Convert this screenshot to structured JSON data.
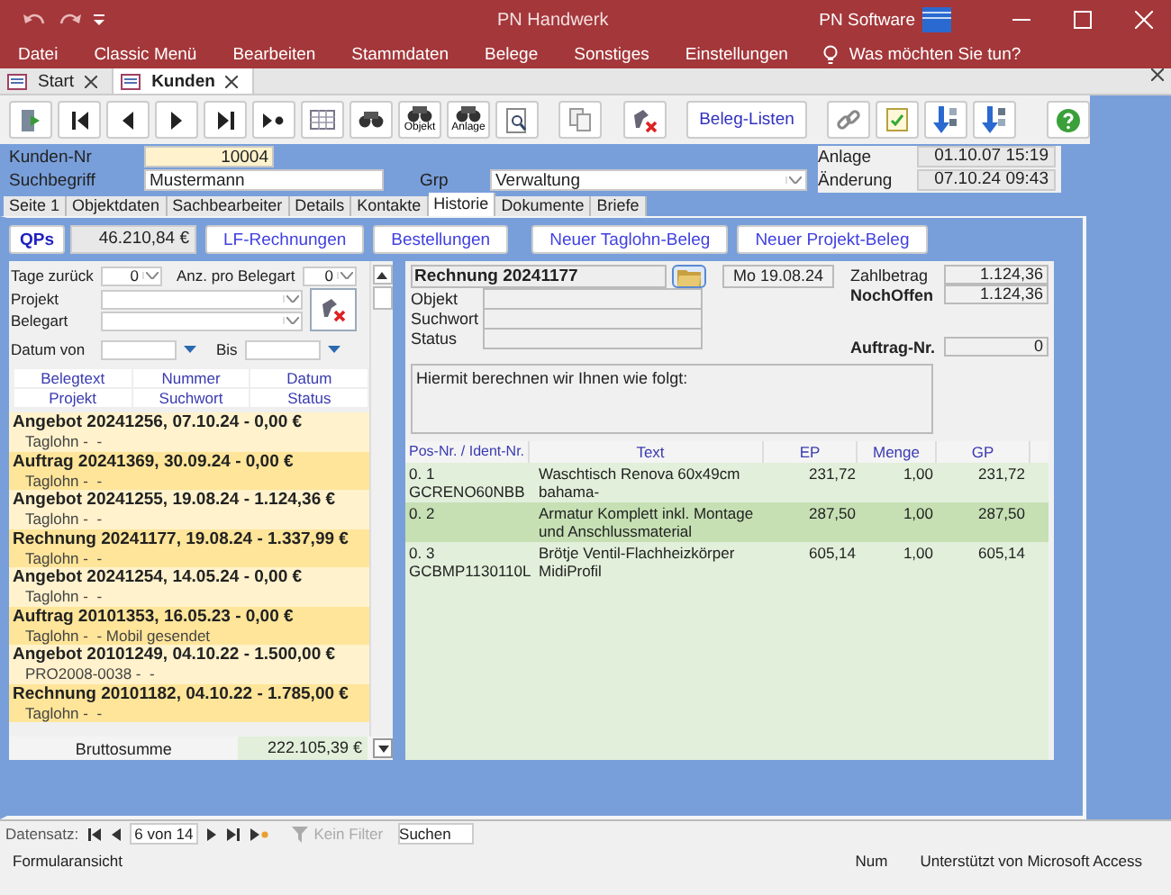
{
  "window": {
    "title": "PN Handwerk",
    "brand": "PN Software"
  },
  "menu": [
    "Datei",
    "Classic Menü",
    "Bearbeiten",
    "Stammdaten",
    "Belege",
    "Sonstiges",
    "Einstellungen"
  ],
  "tell_me": "Was möchten Sie tun?",
  "doc_tabs": [
    {
      "label": "Start",
      "selected": false
    },
    {
      "label": "Kunden",
      "selected": true
    }
  ],
  "toolbar_labels": [
    "Objekt",
    "Anlage",
    "Beleg-Listen"
  ],
  "header": {
    "kunden_nr": {
      "label": "Kunden-Nr",
      "value": "10004"
    },
    "suchbegriff": {
      "label": "Suchbegriff",
      "value": "Mustermann"
    },
    "grp": {
      "label": "Grp",
      "value": "Verwaltung"
    },
    "anlage": {
      "label": "Anlage",
      "value": "01.10.07 15:19"
    },
    "aenderung": {
      "label": "Änderung",
      "value": "07.10.24 09:43"
    }
  },
  "form_tabs": [
    {
      "label": "Seite 1",
      "selected": false
    },
    {
      "label": "Objektdaten",
      "selected": false
    },
    {
      "label": "Sachbearbeiter",
      "selected": false
    },
    {
      "label": "Details",
      "selected": false
    },
    {
      "label": "Kontakte",
      "selected": false
    },
    {
      "label": "Historie",
      "selected": true
    },
    {
      "label": "Dokumente",
      "selected": false
    },
    {
      "label": "Briefe",
      "selected": false
    }
  ],
  "actions": {
    "qps": "QPs",
    "total": "46.210,84 €",
    "buttons": [
      "LF-Rechnungen",
      "Bestellungen",
      "Neuer Taglohn-Beleg",
      "Neuer Projekt-Beleg"
    ]
  },
  "filters": {
    "tage_zurueck": {
      "label": "Tage zurück",
      "value": "0"
    },
    "anz": {
      "label": "Anz. pro Belegart",
      "value": "0"
    },
    "projekt": {
      "label": "Projekt"
    },
    "belegart": {
      "label": "Belegart"
    },
    "datum_von": {
      "label": "Datum von"
    },
    "bis": {
      "label": "Bis"
    }
  },
  "list_columns": [
    [
      "Belegtext",
      "Nummer",
      "Datum"
    ],
    [
      "Projekt",
      "Suchwort",
      "Status"
    ]
  ],
  "belege": [
    {
      "title": "Angebot 20241256, 07.10.24 - 0,00 €",
      "sub": "Taglohn -  -"
    },
    {
      "title": "Auftrag 20241369, 30.09.24 - 0,00 €",
      "sub": "Taglohn -  -"
    },
    {
      "title": "Angebot 20241255, 19.08.24 - 1.124,36 €",
      "sub": "Taglohn -  -"
    },
    {
      "title": "Rechnung 20241177, 19.08.24 - 1.337,99 €",
      "sub": "Taglohn -  -"
    },
    {
      "title": "Angebot 20241254, 14.05.24 - 0,00 €",
      "sub": "Taglohn -  -"
    },
    {
      "title": "Auftrag 20101353, 16.05.23 - 0,00 €",
      "sub": "Taglohn -  - Mobil gesendet"
    },
    {
      "title": "Angebot 20101249, 04.10.22 - 1.500,00 €",
      "sub": "PRO2008-0038 -  -"
    },
    {
      "title": "Rechnung 20101182, 04.10.22 - 1.785,00 €",
      "sub": "Taglohn -  -"
    }
  ],
  "bruttosumme": {
    "label": "Bruttosumme",
    "value": "222.105,39 €"
  },
  "beleg": {
    "title": "Rechnung 20241177",
    "date": "Mo 19.08.24",
    "fields": [
      "Objekt",
      "Suchwort",
      "Status"
    ],
    "zahlbetrag": {
      "label": "Zahlbetrag",
      "value": "1.124,36"
    },
    "nochoffen": {
      "label": "NochOffen",
      "value": "1.124,36"
    },
    "auftrag": {
      "label": "Auftrag-Nr.",
      "value": "0"
    },
    "text": "Hiermit berechnen wir Ihnen wie folgt:"
  },
  "positions": {
    "columns": [
      "Pos-Nr. / Ident-Nr.",
      "Text",
      "EP",
      "Menge",
      "GP"
    ],
    "rows": [
      {
        "pos": "0.  1",
        "ident": "GCRENO60NBB",
        "text": "Waschtisch Renova 60x49cm bahama-",
        "ep": "231,72",
        "menge": "1,00",
        "gp": "231,72",
        "selected": false
      },
      {
        "pos": "0.  2",
        "text": "Armatur Komplett inkl. Montage und Anschlussmaterial",
        "ep": "287,50",
        "menge": "1,00",
        "gp": "287,50",
        "selected": true
      },
      {
        "pos": "0.  3",
        "ident": "GCBMP1130110L",
        "text": "Brötje Ventil-Flachheizkörper MidiProfil",
        "ep": "605,14",
        "menge": "1,00",
        "gp": "605,14",
        "selected": false
      }
    ]
  },
  "record_nav": {
    "label": "Datensatz:",
    "position": "6 von 14",
    "filter": "Kein Filter",
    "search": "Suchen"
  },
  "status_bar": {
    "left": "Formularansicht",
    "right": [
      "Num",
      "Unterstützt von Microsoft Access"
    ]
  }
}
